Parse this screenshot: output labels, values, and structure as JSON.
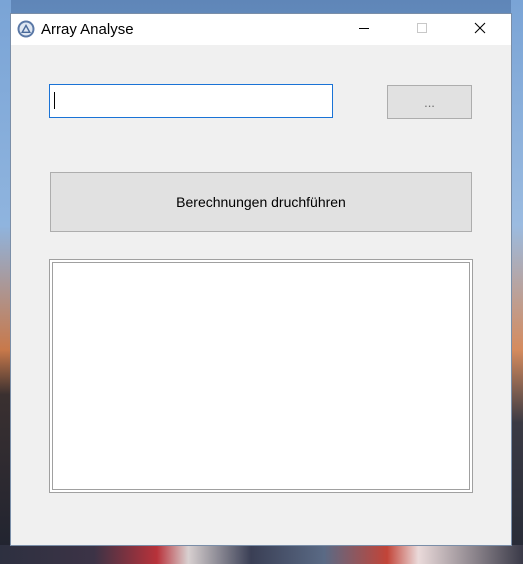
{
  "window": {
    "title": "Array Analyse",
    "controls": {
      "minimize_icon": "minimize-icon",
      "maximize_icon": "maximize-icon",
      "close_icon": "close-icon"
    }
  },
  "form": {
    "path_input": {
      "value": "",
      "placeholder": ""
    },
    "browse_label": "...",
    "calculate_label": "Berechnungen druchführen",
    "output_text": ""
  },
  "colors": {
    "input_focus_border": "#1a73d6",
    "button_face": "#e1e1e1",
    "window_bg": "#f0f0f0"
  }
}
